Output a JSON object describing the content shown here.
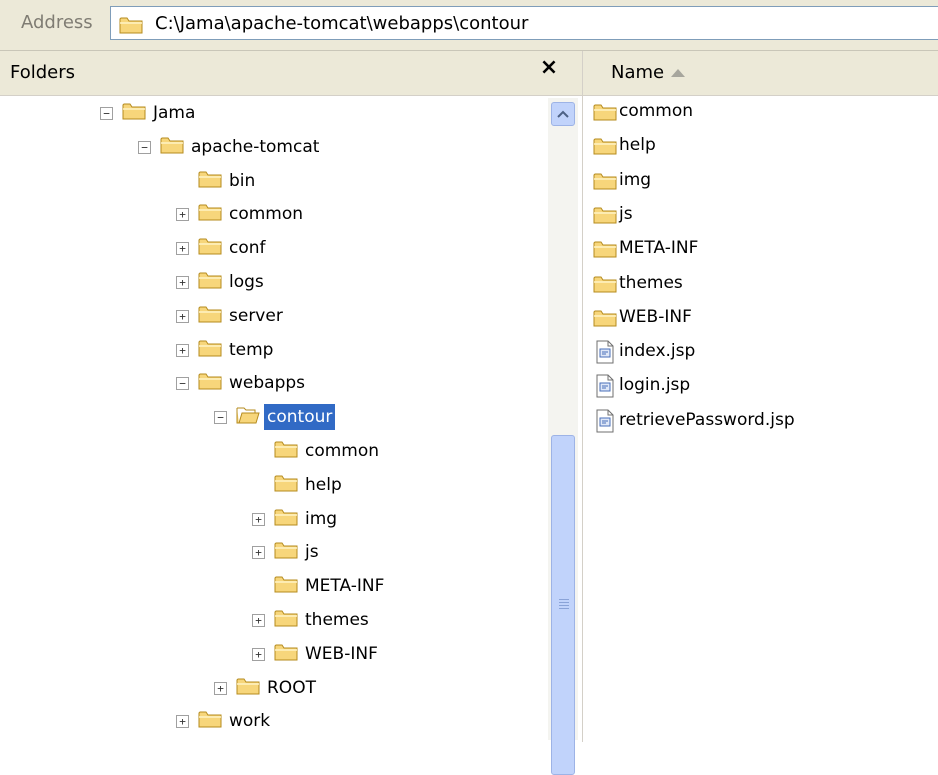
{
  "address": {
    "label": "Address",
    "path": "C:\\Jama\\apache-tomcat\\webapps\\contour"
  },
  "folders_pane": {
    "title": "Folders",
    "close": "×",
    "tree": [
      {
        "label": "Jama",
        "expander": "−"
      },
      {
        "label": "apache-tomcat",
        "expander": "−"
      },
      {
        "label": "bin",
        "expander": ""
      },
      {
        "label": "common",
        "expander": "+"
      },
      {
        "label": "conf",
        "expander": "+"
      },
      {
        "label": "logs",
        "expander": "+"
      },
      {
        "label": "server",
        "expander": "+"
      },
      {
        "label": "temp",
        "expander": "+"
      },
      {
        "label": "webapps",
        "expander": "−"
      },
      {
        "label": "contour",
        "expander": "−",
        "selected": true
      },
      {
        "label": "common",
        "expander": ""
      },
      {
        "label": "help",
        "expander": ""
      },
      {
        "label": "img",
        "expander": "+"
      },
      {
        "label": "js",
        "expander": "+"
      },
      {
        "label": "META-INF",
        "expander": ""
      },
      {
        "label": "themes",
        "expander": "+"
      },
      {
        "label": "WEB-INF",
        "expander": "+"
      },
      {
        "label": "ROOT",
        "expander": "+"
      },
      {
        "label": "work",
        "expander": "+"
      }
    ]
  },
  "list_pane": {
    "column_name": "Name",
    "items": [
      {
        "label": "common",
        "type": "folder"
      },
      {
        "label": "help",
        "type": "folder"
      },
      {
        "label": "img",
        "type": "folder"
      },
      {
        "label": "js",
        "type": "folder"
      },
      {
        "label": "META-INF",
        "type": "folder"
      },
      {
        "label": "themes",
        "type": "folder"
      },
      {
        "label": "WEB-INF",
        "type": "folder"
      },
      {
        "label": "index.jsp",
        "type": "file"
      },
      {
        "label": "login.jsp",
        "type": "file"
      },
      {
        "label": "retrievePassword.jsp",
        "type": "file"
      }
    ]
  },
  "colors": {
    "selection": "#316ac5",
    "folder_fill": "#f7d67b",
    "toolbar_bg": "#ece9d8",
    "scroll": "#c1d3fb"
  }
}
